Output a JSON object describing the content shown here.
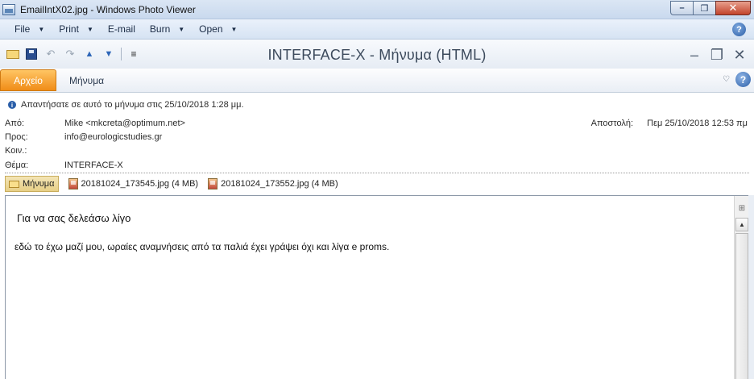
{
  "window": {
    "title": "EmailIntX02.jpg - Windows Photo Viewer",
    "minimize": "–",
    "maximize": "❐",
    "close": "✕"
  },
  "viewer_menu": {
    "items": [
      "File",
      "Print",
      "E-mail",
      "Burn",
      "Open"
    ],
    "caret": "▼",
    "help": "?"
  },
  "outlook": {
    "window_title": "INTERFACE-X  -  Μήνυμα (HTML)",
    "qat": {
      "undo": "↶",
      "redo": "↷",
      "up": "▲",
      "down": "▼",
      "customize": "≡"
    },
    "winbtns": {
      "minimize": "–",
      "restore": "❐",
      "close": "✕"
    },
    "ribbon": {
      "file_tab": "Αρχείο",
      "message_tab": "Μήνυμα",
      "collapse": "♡",
      "help": "?"
    }
  },
  "header": {
    "info_text": "Απαντήσατε σε αυτό το μήνυμα στις 25/10/2018 1:28 μμ.",
    "from_label": "Από:",
    "from_value": "Mike <mkcreta@optimum.net>",
    "to_label": "Προς:",
    "to_value": "info@eurologicstudies.gr",
    "cc_label": "Κοιν.:",
    "cc_value": "",
    "subject_label": "Θέμα:",
    "subject_value": "INTERFACE-X",
    "sent_label": "Αποστολή:",
    "sent_value": "Πεμ 25/10/2018 12:53 πμ"
  },
  "attachments": {
    "message_chip": "Μήνυμα",
    "files": [
      {
        "name": "20181024_173545.jpg",
        "size": "(4 MB)"
      },
      {
        "name": "20181024_173552.jpg",
        "size": "(4 MB)"
      }
    ]
  },
  "body": {
    "line1": "Για να σας δελεάσω λίγο",
    "line2": "εδώ το έχω μαζί μου, ωραίες αναμνήσεις από τα παλιά έχει γράψει όχι και λίγα e proms."
  },
  "scrollbar": {
    "ruler_icon": "⊞",
    "up_arrow": "▲"
  }
}
